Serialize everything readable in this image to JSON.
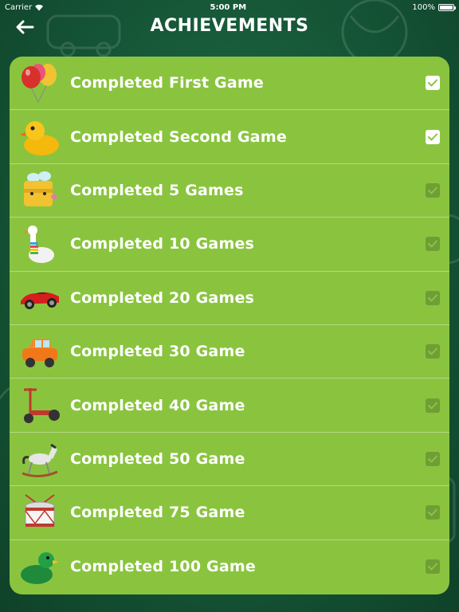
{
  "status_bar": {
    "carrier": "Carrier",
    "time": "5:00 PM",
    "battery_percent": "100%"
  },
  "header": {
    "title": "ACHIEVEMENTS",
    "back_icon": "back-arrow-icon"
  },
  "colors": {
    "background": "#155536",
    "panel": "#8ac43f",
    "check_done": "#ffffff",
    "check_pending": "#6f9e36"
  },
  "achievements": [
    {
      "label": "Completed First Game",
      "icon": "balloons-icon",
      "completed": true
    },
    {
      "label": "Completed Second Game",
      "icon": "rubber-duck-icon",
      "completed": true
    },
    {
      "label": "Completed 5 Games",
      "icon": "bee-cube-icon",
      "completed": false
    },
    {
      "label": "Completed 10 Games",
      "icon": "goose-icon",
      "completed": false
    },
    {
      "label": "Completed 20 Games",
      "icon": "red-race-car-icon",
      "completed": false
    },
    {
      "label": "Completed 30 Game",
      "icon": "toy-car-icon",
      "completed": false
    },
    {
      "label": "Completed 40 Game",
      "icon": "scooter-icon",
      "completed": false
    },
    {
      "label": "Completed 50 Game",
      "icon": "rocking-horse-icon",
      "completed": false
    },
    {
      "label": "Completed 75 Game",
      "icon": "drum-icon",
      "completed": false
    },
    {
      "label": "Completed 100 Game",
      "icon": "green-duck-icon",
      "completed": false
    }
  ]
}
